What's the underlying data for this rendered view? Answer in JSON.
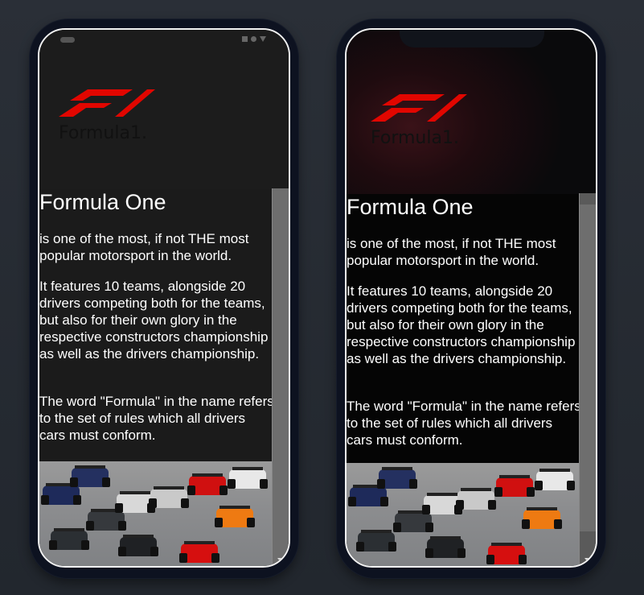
{
  "app": {
    "logo_text": "Formula",
    "logo_number": "1",
    "logo_dot": "."
  },
  "article": {
    "title": "Formula One",
    "paragraphs": [
      "is one of the most, if not THE most popular motorsport in the world.",
      "It features 10 teams, alongside 20 drivers competing both for the teams, but also for their own glory in the respective constructors championship as well as the drivers championship.",
      "The word \"Formula\" in the name refers to the set of rules which all drivers cars must conform."
    ]
  },
  "image": {
    "subject": "formula-one-race-start-photo"
  },
  "colors": {
    "background": "#272c34",
    "phone_frame": "#0d1220",
    "f1_red": "#e10600",
    "text": "#ffffff",
    "content_bg_left": "#1b1b1b",
    "content_bg_right": "#050505"
  }
}
